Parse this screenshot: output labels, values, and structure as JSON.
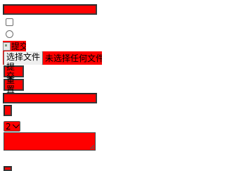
{
  "form": {
    "image_alt": "提交",
    "file_button_label": "选择文件",
    "file_status": "未选择任何文件",
    "submit_label": "提交",
    "reset_label": "重置",
    "select_value": "2"
  },
  "colors": {
    "field_background": "#ff0000",
    "field_border": "#3a3a3a"
  },
  "icons": {
    "broken_image": "broken-image-icon",
    "dropdown": "chevron-down-icon",
    "resize": "resize-grip-icon"
  }
}
